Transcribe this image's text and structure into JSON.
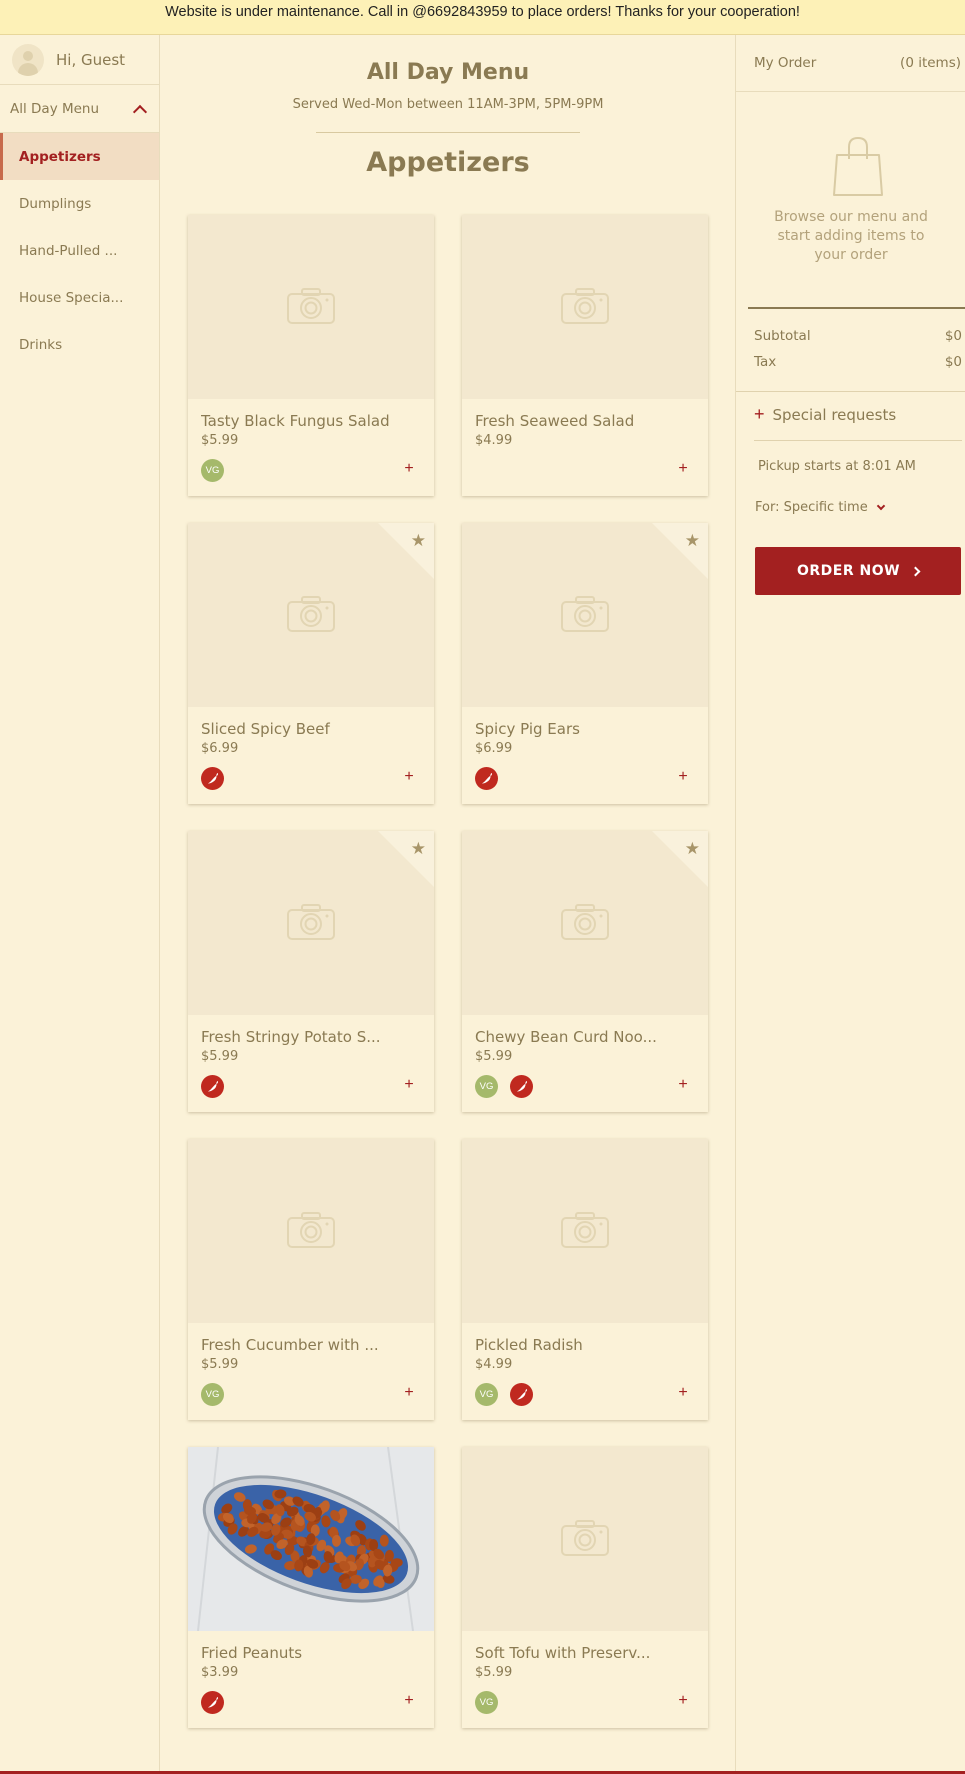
{
  "banner": {
    "text": "Website is under maintenance. Call in @6692843959 to place orders! Thanks for your cooperation!"
  },
  "sidebar": {
    "greeting": "Hi, Guest",
    "menu_name": "All Day Menu",
    "categories": [
      {
        "label": "Appetizers"
      },
      {
        "label": "Dumplings"
      },
      {
        "label": "Hand-Pulled ..."
      },
      {
        "label": "House Specia..."
      },
      {
        "label": "Drinks"
      }
    ]
  },
  "main": {
    "title": "All Day Menu",
    "subtitle": "Served Wed-Mon between 11AM-3PM, 5PM-9PM",
    "section": "Appetizers",
    "items": [
      {
        "name": "Tasty Black Fungus Salad",
        "price": "$5.99",
        "badges": [
          "vegetarian-icon"
        ],
        "badge_text": "VG",
        "featured": false,
        "photo": false
      },
      {
        "name": "Fresh Seaweed Salad",
        "price": "$4.99",
        "badges": [],
        "featured": false,
        "photo": false
      },
      {
        "name": "Sliced Spicy Beef",
        "price": "$6.99",
        "badges": [
          "spicy-icon"
        ],
        "featured": true,
        "photo": false
      },
      {
        "name": "Spicy Pig Ears",
        "price": "$6.99",
        "badges": [
          "spicy-icon"
        ],
        "featured": true,
        "photo": false
      },
      {
        "name": "Fresh Stringy Potato S...",
        "price": "$5.99",
        "badges": [
          "spicy-icon"
        ],
        "featured": true,
        "photo": false
      },
      {
        "name": "Chewy Bean Curd Noo...",
        "price": "$5.99",
        "badges": [
          "vegetarian-icon",
          "spicy-icon"
        ],
        "badge_text": "VG",
        "featured": true,
        "photo": false
      },
      {
        "name": "Fresh Cucumber with ...",
        "price": "$5.99",
        "badges": [
          "vegetarian-icon"
        ],
        "badge_text": "VG",
        "featured": false,
        "photo": false
      },
      {
        "name": "Pickled Radish",
        "price": "$4.99",
        "badges": [
          "vegetarian-icon",
          "spicy-icon"
        ],
        "badge_text": "VG",
        "featured": false,
        "photo": false
      },
      {
        "name": "Fried Peanuts",
        "price": "$3.99",
        "badges": [
          "spicy-icon"
        ],
        "featured": false,
        "photo": true
      },
      {
        "name": "Soft Tofu with Preserv...",
        "price": "$5.99",
        "badges": [
          "vegetarian-icon"
        ],
        "badge_text": "VG",
        "featured": false,
        "photo": false
      }
    ],
    "add_label": "+"
  },
  "order": {
    "title": "My Order",
    "count": "(0 items)",
    "empty_text": "Browse our menu and start adding items to your order",
    "subtotal_label": "Subtotal",
    "subtotal_value": "$0",
    "tax_label": "Tax",
    "tax_value": "$0",
    "special_label": "Special requests",
    "pickup_text": "Pickup starts at 8:01 AM",
    "for_label": "For: Specific time",
    "order_button": "ORDER NOW"
  },
  "colors": {
    "accent": "#a32020",
    "background": "#fbf2d8",
    "banner": "#fdf1b7",
    "vegetarian": "#a5b96b",
    "spicy": "#c0291f"
  }
}
